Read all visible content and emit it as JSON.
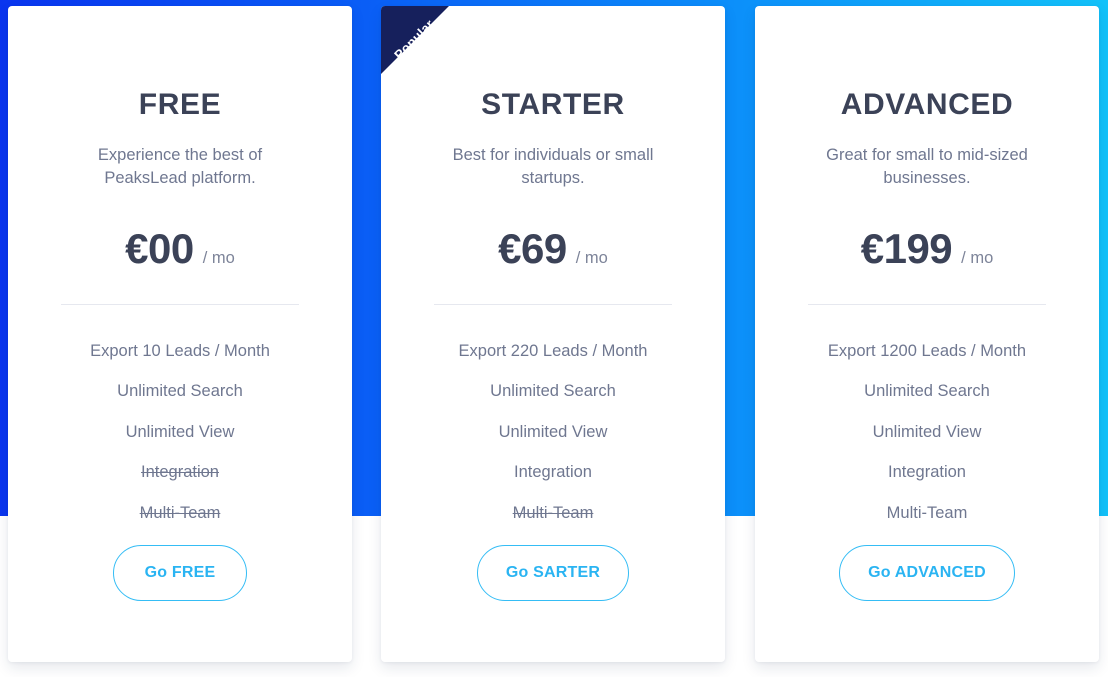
{
  "theme": {
    "gradient_start": "#0a35ef",
    "gradient_end": "#13c2f9",
    "ribbon_color": "#16205c",
    "accent_button": "#2ab4f2",
    "heading_color": "#3b4257",
    "body_text_color": "#6f7790"
  },
  "plans": [
    {
      "name": "FREE",
      "tagline": "Experience the best of PeaksLead platform.",
      "price": "€00",
      "period": "/ mo",
      "badge": null,
      "features": [
        {
          "label": "Export 10 Leads / Month",
          "included": true
        },
        {
          "label": "Unlimited Search",
          "included": true
        },
        {
          "label": "Unlimited View",
          "included": true
        },
        {
          "label": "Integration",
          "included": false
        },
        {
          "label": "Multi-Team",
          "included": false
        }
      ],
      "cta": "Go FREE"
    },
    {
      "name": "STARTER",
      "tagline": "Best for individuals or small startups.",
      "price": "€69",
      "period": "/ mo",
      "badge": "Popular",
      "features": [
        {
          "label": "Export 220 Leads / Month",
          "included": true
        },
        {
          "label": "Unlimited Search",
          "included": true
        },
        {
          "label": "Unlimited View",
          "included": true
        },
        {
          "label": "Integration",
          "included": true
        },
        {
          "label": "Multi-Team",
          "included": false
        }
      ],
      "cta": "Go SARTER"
    },
    {
      "name": "ADVANCED",
      "tagline": "Great for small to mid-sized businesses.",
      "price": "€199",
      "period": "/ mo",
      "badge": null,
      "features": [
        {
          "label": "Export 1200 Leads / Month",
          "included": true
        },
        {
          "label": "Unlimited Search",
          "included": true
        },
        {
          "label": "Unlimited View",
          "included": true
        },
        {
          "label": "Integration",
          "included": true
        },
        {
          "label": "Multi-Team",
          "included": true
        }
      ],
      "cta": "Go ADVANCED"
    }
  ]
}
